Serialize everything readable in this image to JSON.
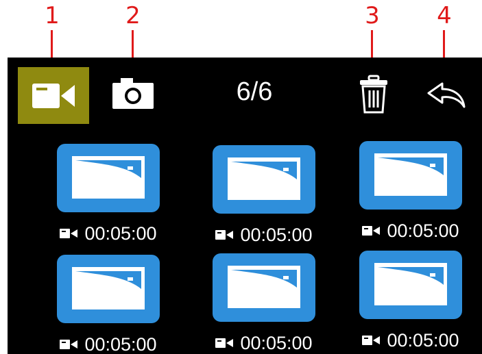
{
  "callouts": [
    "1",
    "2",
    "3",
    "4"
  ],
  "toolbar": {
    "video_icon": "video-camera-icon",
    "photo_icon": "camera-icon",
    "counter": "6/6",
    "delete_icon": "trash-icon",
    "back_icon": "back-arrow-icon",
    "active_color": "#8f8a10"
  },
  "files": [
    {
      "type_icon": "video-camera-icon",
      "duration": "00:05:00"
    },
    {
      "type_icon": "video-camera-icon",
      "duration": "00:05:00"
    },
    {
      "type_icon": "video-camera-icon",
      "duration": "00:05:00"
    },
    {
      "type_icon": "video-camera-icon",
      "duration": "00:05:00"
    },
    {
      "type_icon": "video-camera-icon",
      "duration": "00:05:00"
    },
    {
      "type_icon": "video-camera-icon",
      "duration": "00:05:00"
    }
  ],
  "colors": {
    "callout": "#e01a1a",
    "screen_bg": "#000000",
    "thumb_blue": "#2f8fdb"
  }
}
